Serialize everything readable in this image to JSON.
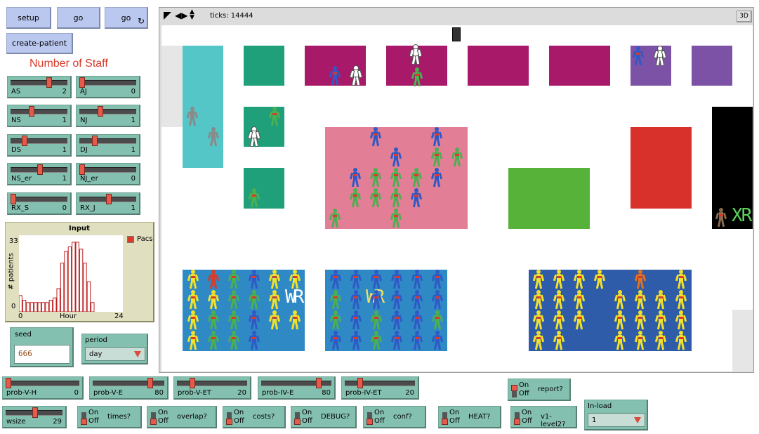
{
  "buttons": {
    "setup": "setup",
    "go": "go",
    "go_forever": "go",
    "forever_glyph": "↻",
    "create_patient": "create-patient"
  },
  "staff_title": "Number of Staff",
  "sliders": {
    "AS": {
      "label": "AS",
      "value": "2",
      "fraction": 0.55
    },
    "AJ": {
      "label": "AJ",
      "value": "0",
      "fraction": 0.0
    },
    "NS": {
      "label": "NS",
      "value": "1",
      "fraction": 0.3
    },
    "NJ": {
      "label": "NJ",
      "value": "1",
      "fraction": 0.3
    },
    "DS": {
      "label": "DS",
      "value": "1",
      "fraction": 0.15
    },
    "DJ": {
      "label": "DJ",
      "value": "1",
      "fraction": 0.2
    },
    "NS_er": {
      "label": "NS_er",
      "value": "1",
      "fraction": 0.5
    },
    "NJ_er": {
      "label": "NJ_er",
      "value": "0",
      "fraction": 0.0
    },
    "RX_S": {
      "label": "RX_S",
      "value": "0",
      "fraction": 0.0
    },
    "RX_J": {
      "label": "RX_J",
      "value": "1",
      "fraction": 0.45
    },
    "prob_V_H": {
      "label": "prob-V-H",
      "value": "0",
      "fraction": 0.0
    },
    "prob_V_E": {
      "label": "prob-V-E",
      "value": "80",
      "fraction": 0.8
    },
    "prob_V_ET": {
      "label": "prob-V-ET",
      "value": "20",
      "fraction": 0.2
    },
    "prob_IV_E": {
      "label": "prob-IV-E",
      "value": "80",
      "fraction": 0.8
    },
    "prob_IV_ET": {
      "label": "prob-IV-ET",
      "value": "20",
      "fraction": 0.2
    },
    "wsize": {
      "label": "wsize",
      "value": "29",
      "fraction": 0.5
    }
  },
  "plot": {
    "title": "Input",
    "ylabel": "# patients",
    "xlabel": "Hour",
    "ymax_label": "33",
    "ymin_label": "0",
    "xmin_label": "0",
    "xmax_label": "24",
    "legend": "Pacs",
    "legend_color": "#d93a2a"
  },
  "chart_data": {
    "type": "bar",
    "title": "Input",
    "xlabel": "Hour",
    "ylabel": "# patients",
    "xlim": [
      0,
      24
    ],
    "ylim": [
      0,
      33
    ],
    "series": [
      {
        "name": "Pacs",
        "values": [
          7,
          5,
          4,
          4,
          4,
          4,
          4,
          4,
          5,
          6,
          10,
          21,
          26,
          28,
          30,
          30,
          27,
          21,
          13,
          4
        ]
      }
    ]
  },
  "seed": {
    "label": "seed",
    "value": "666"
  },
  "period": {
    "label": "period",
    "value": "day"
  },
  "inload": {
    "label": "In-load",
    "value": "1"
  },
  "switches": {
    "on": "On",
    "off": "Off",
    "report": "report?",
    "times": "times?",
    "overlap": "overlap?",
    "costs": "costs?",
    "debug": "DEBUG?",
    "conf": "conf?",
    "heat": "HEAT?",
    "v1level2": "v1-level2?"
  },
  "view": {
    "ticks_label": "ticks: 14444",
    "three_d": "3D",
    "wr1": "WR",
    "wr2": "WR",
    "xr": "XR"
  },
  "colors": {
    "button": "#bac7ee",
    "widget": "#84c0b0",
    "plot_bg": "#e0e0c0",
    "staff_title": "#d93a2a"
  }
}
